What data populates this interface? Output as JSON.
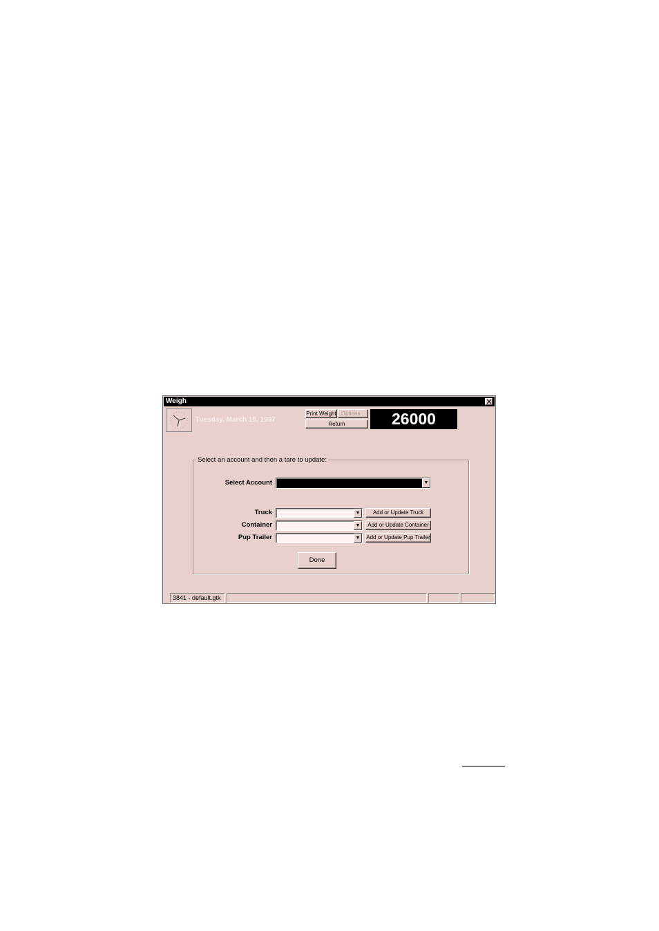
{
  "window": {
    "title": "Weigh",
    "date": "Tuesday, March 18, 1997",
    "weight": "26000"
  },
  "toolbar": {
    "print_weight": "Print Weight",
    "options": "Options...",
    "return": "Return"
  },
  "group": {
    "label": "Select an account and then a tare to update:",
    "select_account_label": "Select Account",
    "truck_label": "Truck",
    "container_label": "Container",
    "pup_trailer_label": "Pup Trailer",
    "add_truck": "Add or Update Truck",
    "add_container": "Add or Update Container",
    "add_pup_trailer": "Add or Update Pup Trailer",
    "done": "Done"
  },
  "statusbar": {
    "file": "3841 - default.gtk"
  }
}
